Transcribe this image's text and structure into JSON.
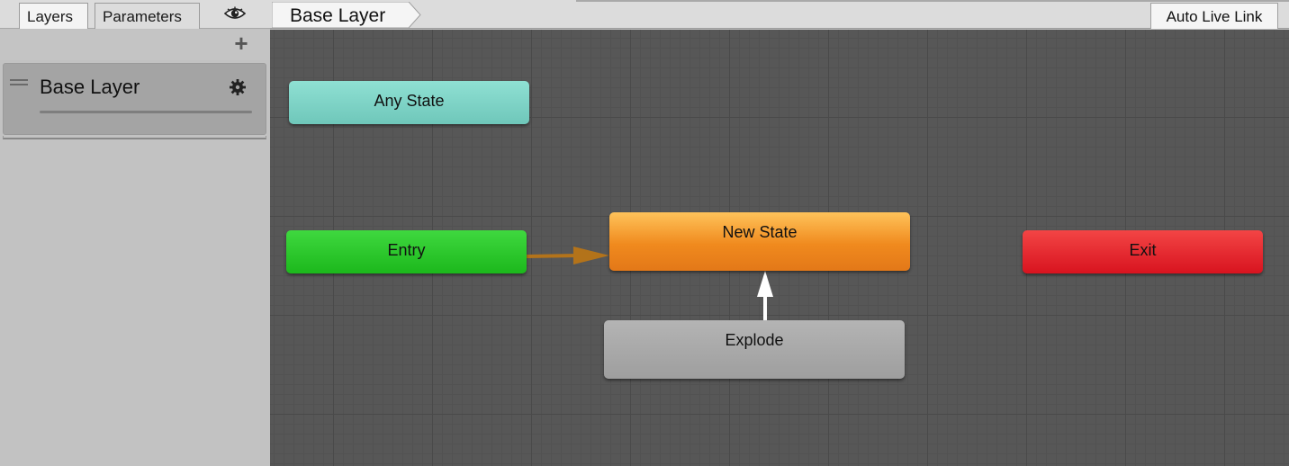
{
  "left_panel": {
    "tabs": [
      {
        "label": "Layers",
        "active": true
      },
      {
        "label": "Parameters",
        "active": false
      }
    ],
    "eye_icon": "eye-icon",
    "add_icon": "plus-icon",
    "layers": [
      {
        "name": "Base Layer",
        "settings_icon": "gear-icon"
      }
    ]
  },
  "graph": {
    "breadcrumb": "Base Layer",
    "auto_live_link_label": "Auto Live Link",
    "states": {
      "any_state": {
        "label": "Any State",
        "color": "#7fd4c8"
      },
      "entry": {
        "label": "Entry",
        "color": "#26c426"
      },
      "new_state": {
        "label": "New State",
        "color": "#f08a1e"
      },
      "exit": {
        "label": "Exit",
        "color": "#e01c26"
      },
      "explode": {
        "label": "Explode",
        "color": "#a8a8a8"
      }
    },
    "transitions": [
      {
        "from": "Entry",
        "to": "New State",
        "color": "#b3731a"
      },
      {
        "from": "Explode",
        "to": "New State",
        "color": "#ffffff"
      }
    ],
    "colors": {
      "background": "#575757",
      "grid_major": "#4a4a4a",
      "grid_minor": "#525252"
    }
  }
}
